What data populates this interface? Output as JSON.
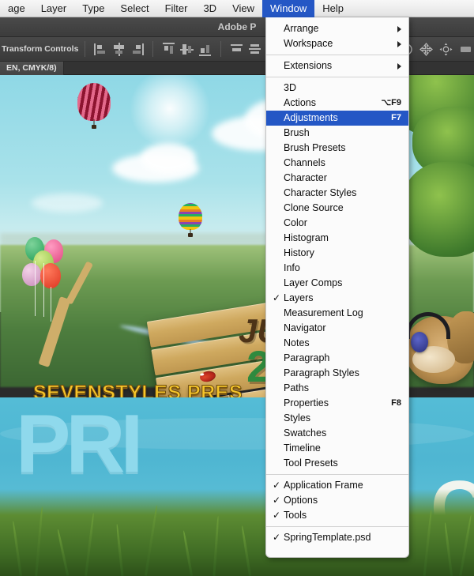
{
  "menubar": {
    "items": [
      {
        "label": "age",
        "active": false
      },
      {
        "label": "Layer",
        "active": false
      },
      {
        "label": "Type",
        "active": false
      },
      {
        "label": "Select",
        "active": false
      },
      {
        "label": "Filter",
        "active": false
      },
      {
        "label": "3D",
        "active": false
      },
      {
        "label": "View",
        "active": false
      },
      {
        "label": "Window",
        "active": true
      },
      {
        "label": "Help",
        "active": false
      }
    ]
  },
  "appbar": {
    "title": "Adobe P"
  },
  "optionsbar": {
    "transform_label": "Transform Controls"
  },
  "tabbar": {
    "doc_tab": "EN, CMYK/8)"
  },
  "window_menu": {
    "groups": [
      {
        "items": [
          {
            "label": "Arrange",
            "shortcut": "",
            "checked": false,
            "submenu": true,
            "selected": false
          },
          {
            "label": "Workspace",
            "shortcut": "",
            "checked": false,
            "submenu": true,
            "selected": false
          }
        ]
      },
      {
        "items": [
          {
            "label": "Extensions",
            "shortcut": "",
            "checked": false,
            "submenu": true,
            "selected": false
          }
        ]
      },
      {
        "items": [
          {
            "label": "3D",
            "shortcut": "",
            "checked": false,
            "submenu": false,
            "selected": false
          },
          {
            "label": "Actions",
            "shortcut": "⌥F9",
            "checked": false,
            "submenu": false,
            "selected": false
          },
          {
            "label": "Adjustments",
            "shortcut": "F7",
            "checked": false,
            "submenu": false,
            "selected": true
          },
          {
            "label": "Brush",
            "shortcut": "",
            "checked": false,
            "submenu": false,
            "selected": false
          },
          {
            "label": "Brush Presets",
            "shortcut": "",
            "checked": false,
            "submenu": false,
            "selected": false
          },
          {
            "label": "Channels",
            "shortcut": "",
            "checked": false,
            "submenu": false,
            "selected": false
          },
          {
            "label": "Character",
            "shortcut": "",
            "checked": false,
            "submenu": false,
            "selected": false
          },
          {
            "label": "Character Styles",
            "shortcut": "",
            "checked": false,
            "submenu": false,
            "selected": false
          },
          {
            "label": "Clone Source",
            "shortcut": "",
            "checked": false,
            "submenu": false,
            "selected": false
          },
          {
            "label": "Color",
            "shortcut": "",
            "checked": false,
            "submenu": false,
            "selected": false
          },
          {
            "label": "Histogram",
            "shortcut": "",
            "checked": false,
            "submenu": false,
            "selected": false
          },
          {
            "label": "History",
            "shortcut": "",
            "checked": false,
            "submenu": false,
            "selected": false
          },
          {
            "label": "Info",
            "shortcut": "",
            "checked": false,
            "submenu": false,
            "selected": false
          },
          {
            "label": "Layer Comps",
            "shortcut": "",
            "checked": false,
            "submenu": false,
            "selected": false
          },
          {
            "label": "Layers",
            "shortcut": "",
            "checked": true,
            "submenu": false,
            "selected": false
          },
          {
            "label": "Measurement Log",
            "shortcut": "",
            "checked": false,
            "submenu": false,
            "selected": false
          },
          {
            "label": "Navigator",
            "shortcut": "",
            "checked": false,
            "submenu": false,
            "selected": false
          },
          {
            "label": "Notes",
            "shortcut": "",
            "checked": false,
            "submenu": false,
            "selected": false
          },
          {
            "label": "Paragraph",
            "shortcut": "",
            "checked": false,
            "submenu": false,
            "selected": false
          },
          {
            "label": "Paragraph Styles",
            "shortcut": "",
            "checked": false,
            "submenu": false,
            "selected": false
          },
          {
            "label": "Paths",
            "shortcut": "",
            "checked": false,
            "submenu": false,
            "selected": false
          },
          {
            "label": "Properties",
            "shortcut": "F8",
            "checked": false,
            "submenu": false,
            "selected": false
          },
          {
            "label": "Styles",
            "shortcut": "",
            "checked": false,
            "submenu": false,
            "selected": false
          },
          {
            "label": "Swatches",
            "shortcut": "",
            "checked": false,
            "submenu": false,
            "selected": false
          },
          {
            "label": "Timeline",
            "shortcut": "",
            "checked": false,
            "submenu": false,
            "selected": false
          },
          {
            "label": "Tool Presets",
            "shortcut": "",
            "checked": false,
            "submenu": false,
            "selected": false
          }
        ]
      },
      {
        "items": [
          {
            "label": "Application Frame",
            "shortcut": "",
            "checked": true,
            "submenu": false,
            "selected": false
          },
          {
            "label": "Options",
            "shortcut": "",
            "checked": true,
            "submenu": false,
            "selected": false
          },
          {
            "label": "Tools",
            "shortcut": "",
            "checked": true,
            "submenu": false,
            "selected": false
          }
        ]
      },
      {
        "items": [
          {
            "label": "SpringTemplate.psd",
            "shortcut": "",
            "checked": true,
            "submenu": false,
            "selected": false
          }
        ]
      }
    ],
    "check_glyph": "✓",
    "highlight_color": "#2457c5"
  },
  "artwork": {
    "headline": "SEVENSTYLES PRES",
    "sign_text_1": "JU",
    "sign_text_2": "2",
    "big_word": "PRI",
    "white_letter": "C"
  }
}
